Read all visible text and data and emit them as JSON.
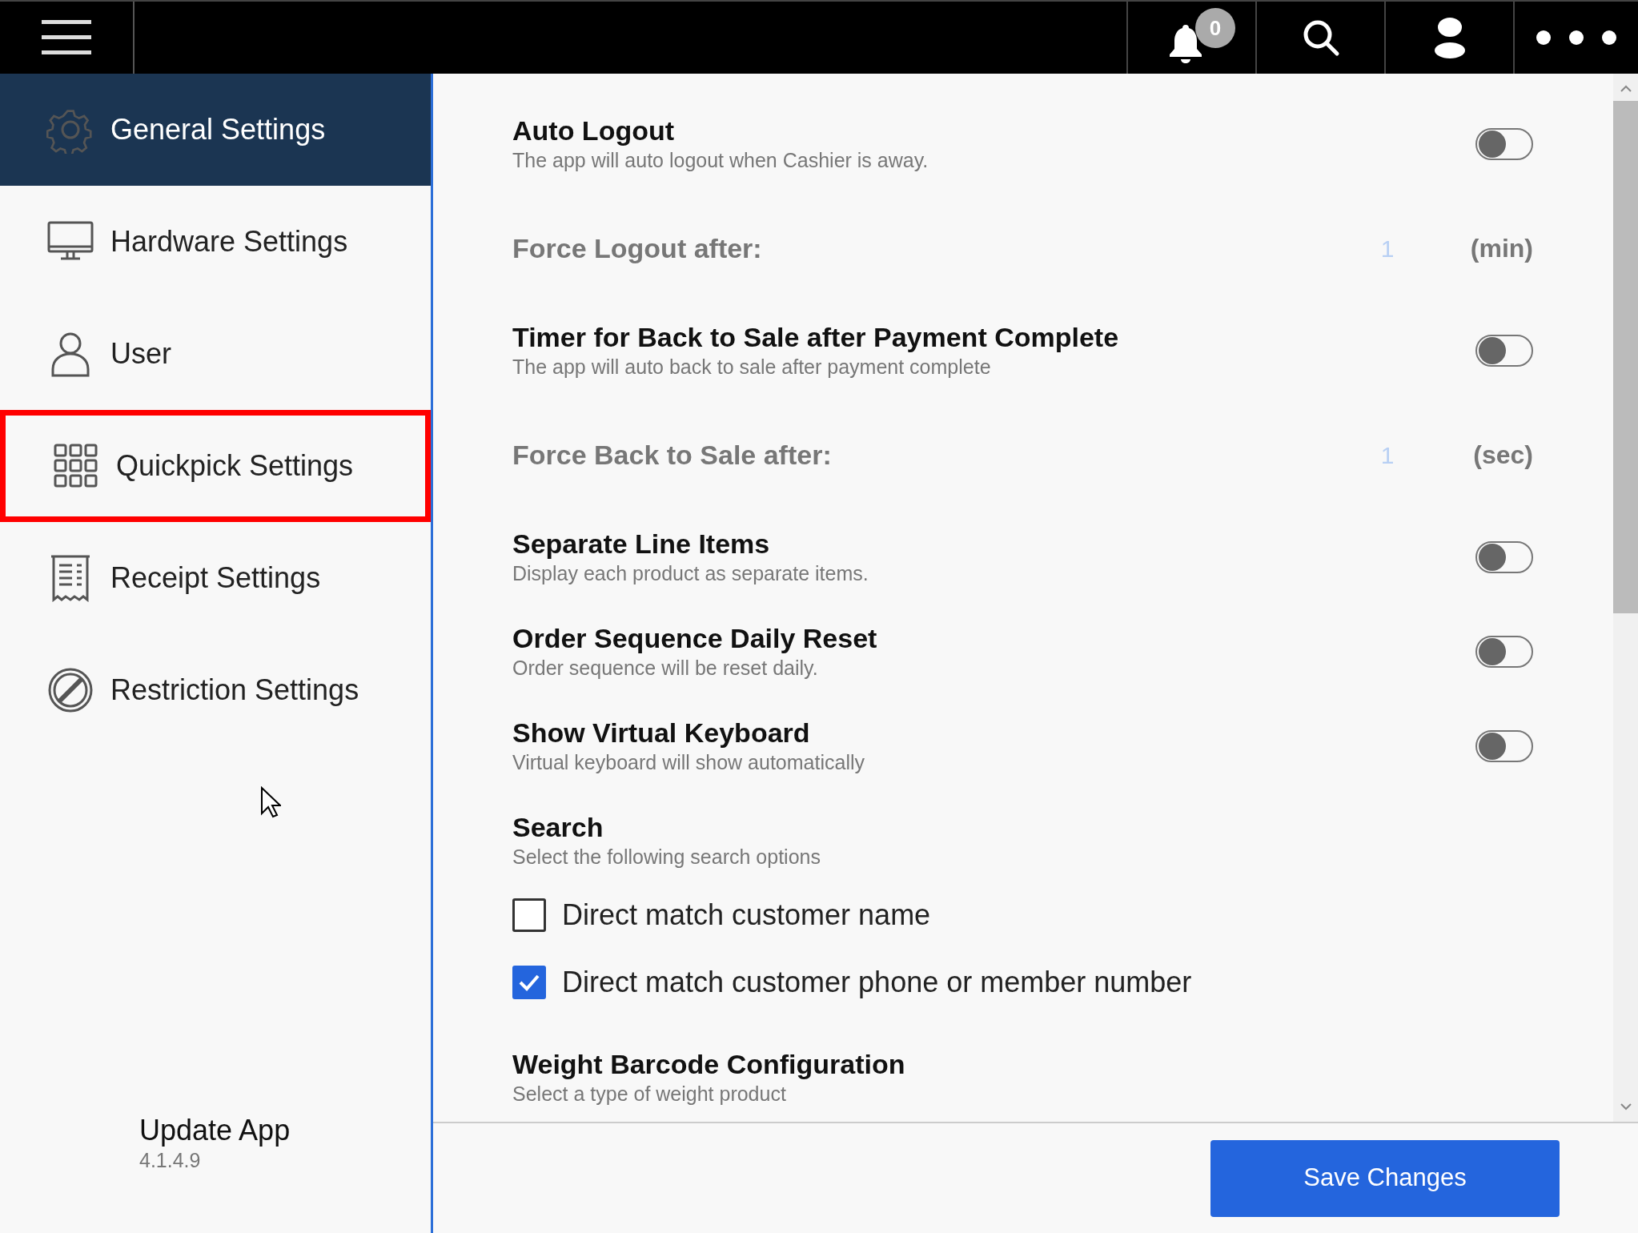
{
  "top_bar": {
    "notification_count": "0"
  },
  "sidebar": {
    "items": [
      {
        "kind": "gear",
        "label": "General Settings",
        "selected": true,
        "highlighted": false
      },
      {
        "kind": "monitor",
        "label": "Hardware Settings",
        "selected": false,
        "highlighted": false
      },
      {
        "kind": "person",
        "label": "User",
        "selected": false,
        "highlighted": false
      },
      {
        "kind": "grid",
        "label": "Quickpick Settings",
        "selected": false,
        "highlighted": true
      },
      {
        "kind": "receipt",
        "label": "Receipt Settings",
        "selected": false,
        "highlighted": false
      },
      {
        "kind": "prohibited",
        "label": "Restriction Settings",
        "selected": false,
        "highlighted": false
      }
    ],
    "update": {
      "label": "Update App",
      "version": "4.1.4.9"
    }
  },
  "settings": [
    {
      "kind": "toggle",
      "title": "Auto Logout",
      "description": "The app will auto logout when Cashier is away.",
      "on": false
    },
    {
      "kind": "value",
      "label": "Force Logout after:",
      "value": "1",
      "unit": "(min)"
    },
    {
      "kind": "toggle",
      "title": "Timer for Back to Sale after Payment Complete",
      "description": "The app will auto back to sale after payment complete",
      "on": false
    },
    {
      "kind": "value",
      "label": "Force Back to Sale after:",
      "value": "1",
      "unit": "(sec)"
    },
    {
      "kind": "toggle",
      "title": "Separate Line Items",
      "description": "Display each product as separate items.",
      "on": false
    },
    {
      "kind": "toggle",
      "title": "Order Sequence Daily Reset",
      "description": "Order sequence will be reset daily.",
      "on": false
    },
    {
      "kind": "toggle",
      "title": "Show Virtual Keyboard",
      "description": "Virtual keyboard will show automatically",
      "on": false
    },
    {
      "kind": "header",
      "title": "Search",
      "description": "Select the following search options"
    },
    {
      "kind": "checkbox",
      "label": "Direct match customer name",
      "checked": false
    },
    {
      "kind": "checkbox",
      "label": "Direct match customer phone or member number",
      "checked": true
    },
    {
      "kind": "section",
      "title": "Weight Barcode Configuration",
      "description": "Select a type of weight product"
    }
  ],
  "save_button": "Save Changes"
}
